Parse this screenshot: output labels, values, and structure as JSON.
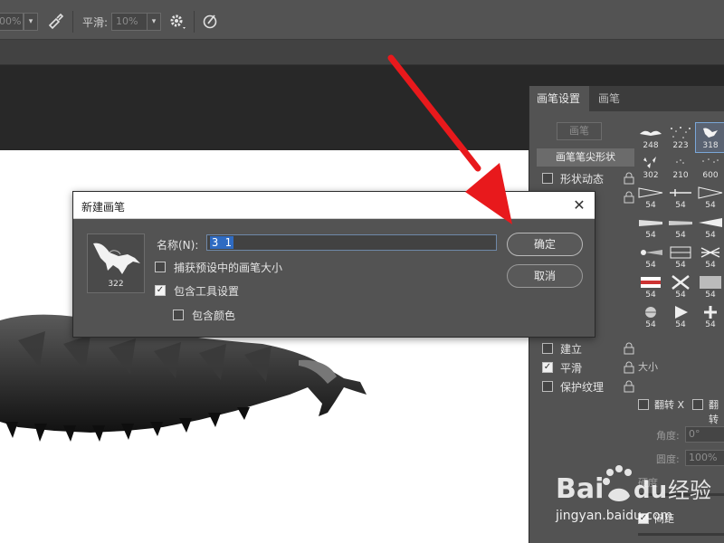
{
  "options_bar": {
    "opacity_value": "00%",
    "smoothing_label": "平滑:",
    "smoothing_value": "10%",
    "icons": [
      "airbrush-icon",
      "gear-icon",
      "pressure-size-icon"
    ]
  },
  "brush_panel": {
    "tabs": [
      {
        "label": "画笔设置"
      },
      {
        "label": "画笔"
      }
    ],
    "presets_button": "画笔",
    "tip_shape": "画笔笔尖形状",
    "options": [
      {
        "label": "形状动态",
        "checked": false
      },
      {
        "label": "建立",
        "checked": false
      },
      {
        "label": "平滑",
        "checked": true
      },
      {
        "label": "保护纹理",
        "checked": false
      }
    ],
    "brushes": [
      "248",
      "223",
      "318",
      "302",
      "210",
      "600",
      "54",
      "54",
      "54",
      "54",
      "54",
      "54",
      "54",
      "54",
      "54",
      "54",
      "54",
      "54",
      "54",
      "54",
      "54"
    ],
    "size_label": "大小",
    "flip_x_label": "翻转 X",
    "flip_y_label": "翻转",
    "angle_label": "角度:",
    "angle_value": "0°",
    "roundness_label": "圆度:",
    "roundness_value": "100%",
    "hardness_label": "硬度",
    "spacing_label": "间距"
  },
  "dialog": {
    "title": "新建画笔",
    "preview_number": "322",
    "name_label": "名称(N):",
    "name_value": "3 1",
    "capture_size_label": "捕获预设中的画笔大小",
    "capture_size_checked": false,
    "include_tool_label": "包含工具设置",
    "include_tool_checked": true,
    "include_color_label": "包含颜色",
    "include_color_checked": false,
    "ok_label": "确定",
    "cancel_label": "取消"
  },
  "watermark": {
    "text": "jingyan.baidu.com"
  },
  "colors": {
    "arrow": "#e8191c",
    "panel_bg": "#535353",
    "selection": "#2f6bc2"
  }
}
